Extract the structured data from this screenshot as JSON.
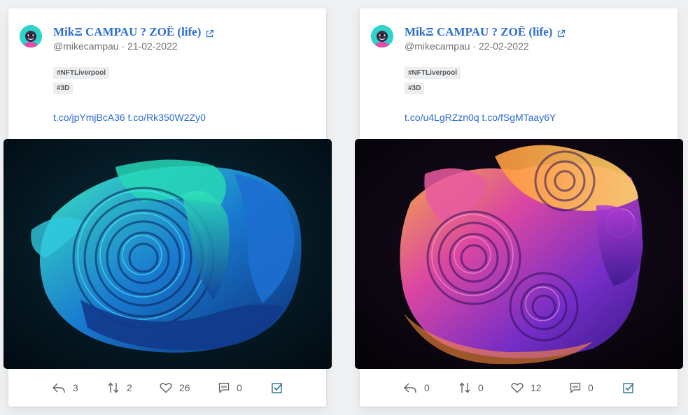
{
  "posts": [
    {
      "author": "MikΞ CAMPAU ? ZOË (life)",
      "handle": "@mikecampau",
      "date": "21-02-2022",
      "tags": [
        "#NFTLiverpool",
        "#3D"
      ],
      "links": [
        "t.co/jpYmjBcA36",
        "t.co/Rk350W2Zy0"
      ],
      "image_theme": "teal-blue",
      "stats": {
        "replies": "3",
        "retweets": "2",
        "likes": "26",
        "quotes": "0"
      }
    },
    {
      "author": "MikΞ CAMPAU ? ZOË (life)",
      "handle": "@mikecampau",
      "date": "22-02-2022",
      "tags": [
        "#NFTLiverpool",
        "#3D"
      ],
      "links": [
        "t.co/u4LgRZzn0q",
        "t.co/fSgMTaay6Y"
      ],
      "image_theme": "purple-orange",
      "stats": {
        "replies": "0",
        "retweets": "0",
        "likes": "12",
        "quotes": "0"
      }
    }
  ],
  "icons": {
    "reply": "reply-icon",
    "retweet": "retweet-icon",
    "like": "heart-icon",
    "quote": "quote-icon",
    "select": "checkbox-icon",
    "external": "external-link-icon"
  },
  "colors": {
    "link": "#2b6cd6",
    "avatar_bg": "#2fd3c9",
    "checkbox": "#2a6f8f"
  }
}
